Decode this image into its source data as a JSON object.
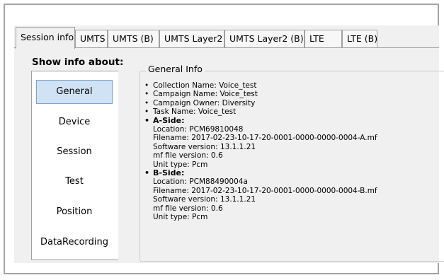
{
  "tabs": [
    "Session info",
    "UMTS",
    "UMTS (B)",
    "UMTS Layer2",
    "UMTS Layer2 (B)",
    "LTE",
    "LTE (B)"
  ],
  "sidebar": {
    "title": "Show info about:",
    "items": [
      "General",
      "Device",
      "Session",
      "Test",
      "Position",
      "DataRecording"
    ],
    "selected": "General"
  },
  "general_info": {
    "title": "General Info",
    "collection_name": "Collection Name: Voice_test",
    "campaign_name": "Campaign Name: Voice_test",
    "campaign_owner": "Campaign Owner: Diversity",
    "task_name": "Task Name: Voice_test",
    "a_side": {
      "heading": "A-Side:",
      "location": "Location: PCM69810048",
      "filename": "Filename: 2017-02-23-10-17-20-0001-0000-0000-0004-A.mf",
      "software_version": "Software version: 13.1.1.21",
      "mf_file_version": "mf file version: 0.6",
      "unit_type": "Unit type: Pcm"
    },
    "b_side": {
      "heading": "B-Side:",
      "location": "Location: PCM88490004a",
      "filename": "Filename: 2017-02-23-10-17-20-0001-0000-0000-0004-B.mf",
      "software_version": "Software version: 13.1.1.21",
      "mf_file_version": "mf file version: 0.6",
      "unit_type": "Unit type: Pcm"
    }
  },
  "colors": {
    "selected_bg": "#cfe3f5",
    "selected_border": "#7da2ce",
    "panel_bg": "#f0f0f0"
  }
}
